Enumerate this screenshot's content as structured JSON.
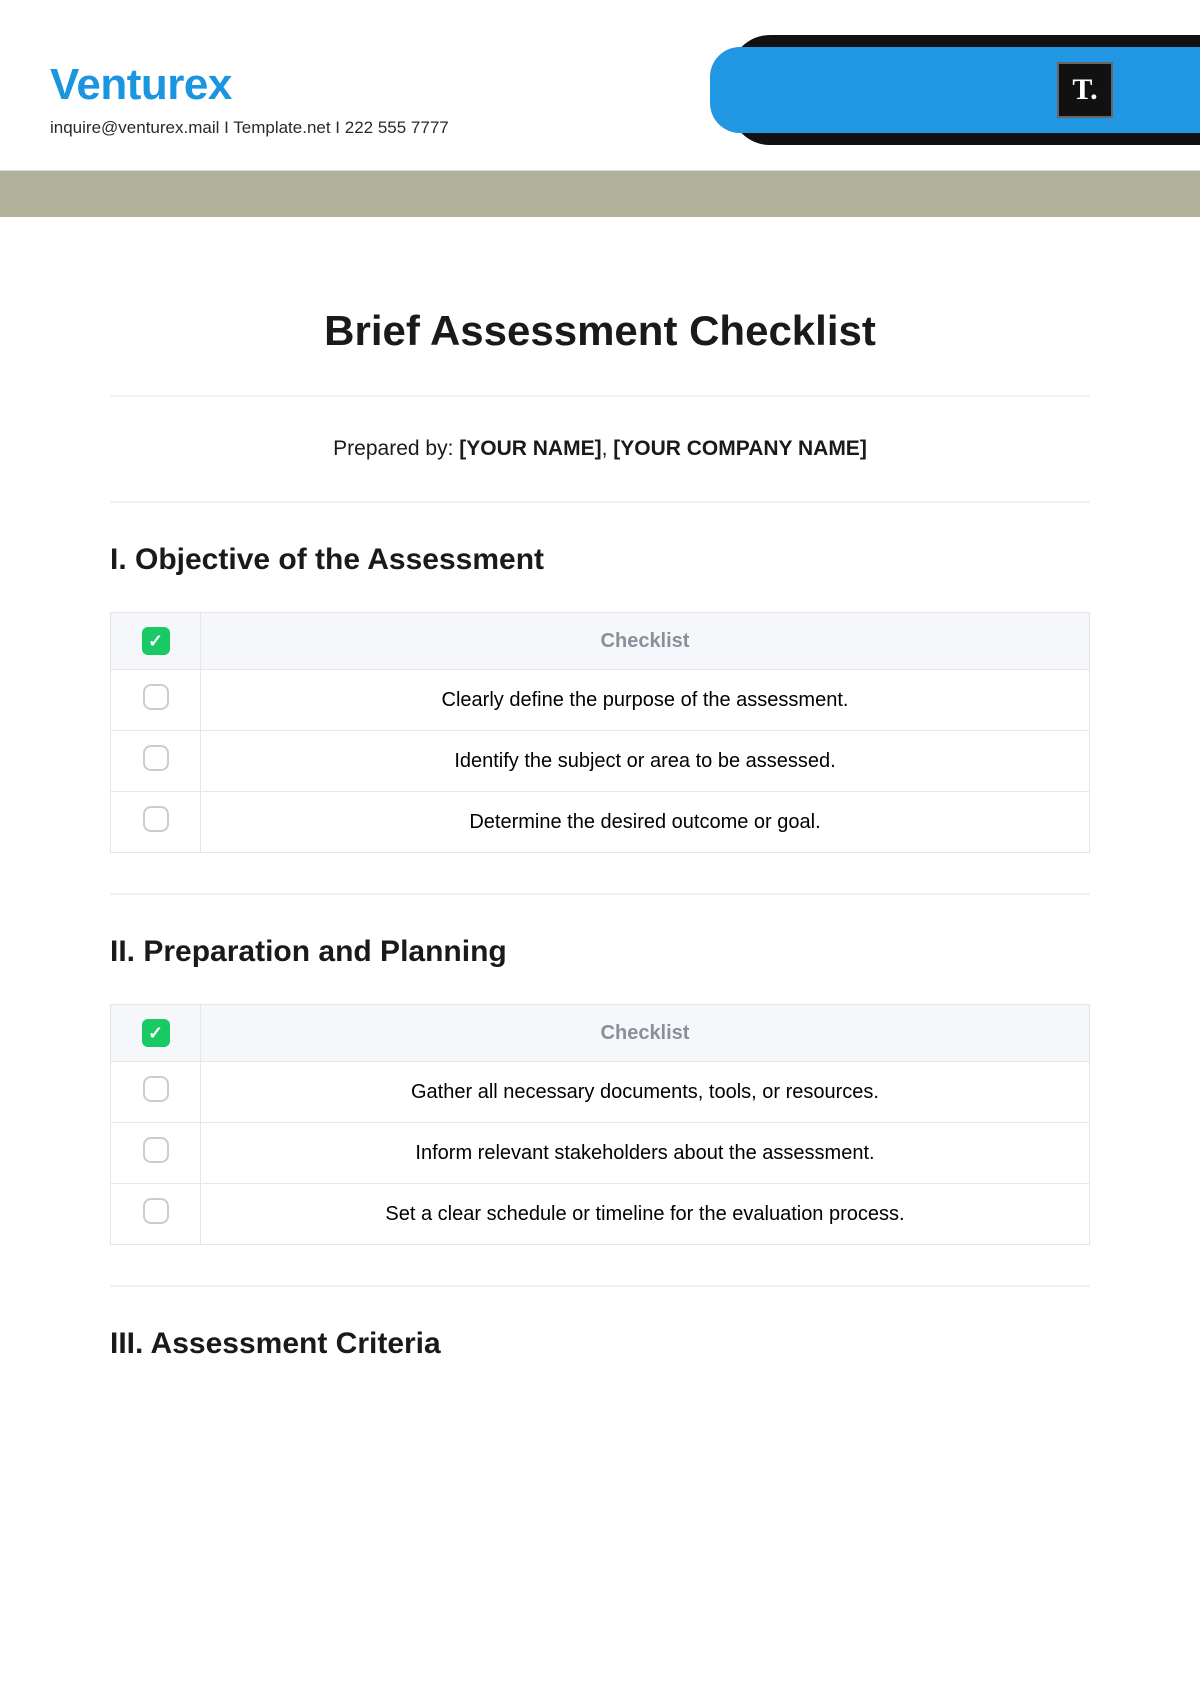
{
  "header": {
    "brand": "Venturex",
    "contact": "inquire@venturex.mail  I  Template.net  I  222 555 7777",
    "logo_text": "T."
  },
  "document": {
    "title": "Brief Assessment Checklist",
    "prepared_label": "Prepared by: ",
    "prepared_name": "[YOUR NAME]",
    "prepared_sep": ", ",
    "prepared_company": "[YOUR COMPANY NAME]"
  },
  "table_header": "Checklist",
  "sections": [
    {
      "heading": "I. Objective of the Assessment",
      "items": [
        "Clearly define the purpose of the assessment.",
        "Identify the subject or area to be assessed.",
        "Determine the desired outcome or goal."
      ]
    },
    {
      "heading": "II. Preparation and Planning",
      "items": [
        "Gather all necessary documents, tools, or resources.",
        "Inform relevant stakeholders about the assessment.",
        "Set a clear schedule or timeline for the evaluation process."
      ]
    },
    {
      "heading": "III. Assessment Criteria",
      "items": []
    }
  ]
}
